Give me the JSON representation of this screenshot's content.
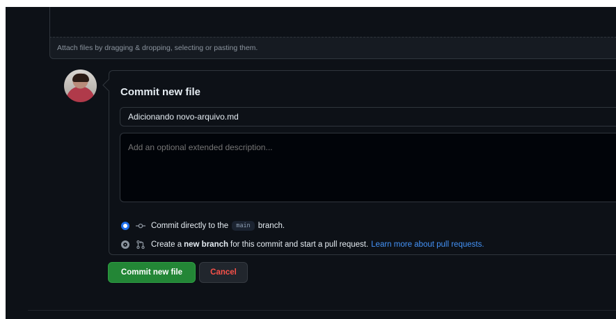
{
  "attach": {
    "hint": "Attach files by dragging & dropping, selecting or pasting them."
  },
  "commit": {
    "title": "Commit new file",
    "summary_value": "Adicionando novo-arquivo.md",
    "description_placeholder": "Add an optional extended description...",
    "option_direct": {
      "prefix": "Commit directly to the",
      "branch": "main",
      "suffix": "branch.",
      "selected": true,
      "icon": "git-commit-icon"
    },
    "option_new_branch": {
      "prefix": "Create a",
      "bold": "new branch",
      "suffix": "for this commit and start a pull request.",
      "link": "Learn more about pull requests.",
      "selected": false,
      "icon": "git-pull-request-icon"
    }
  },
  "buttons": {
    "commit_label": "Commit new file",
    "cancel_label": "Cancel"
  },
  "colors": {
    "background": "#0d1117",
    "border": "#30363d",
    "primary": "#238636",
    "danger": "#f85149",
    "link": "#4493f8",
    "radio_accent": "#1f6feb"
  }
}
